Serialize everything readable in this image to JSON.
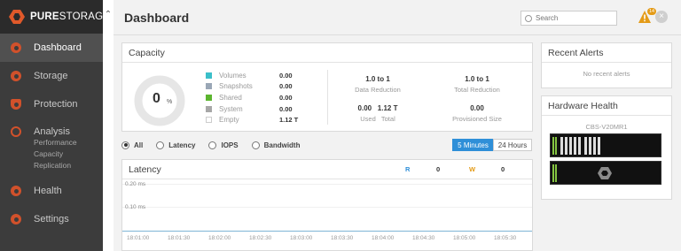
{
  "brand": {
    "bold": "PURE",
    "light": "STORAGE"
  },
  "sidebar": {
    "items": [
      {
        "label": "Dashboard",
        "icon": "dashboard-icon",
        "active": true
      },
      {
        "label": "Storage",
        "icon": "storage-icon",
        "active": false
      },
      {
        "label": "Protection",
        "icon": "shield-icon",
        "active": false
      },
      {
        "label": "Analysis",
        "icon": "analysis-icon",
        "active": false,
        "sub": [
          "Performance",
          "Capacity",
          "Replication"
        ]
      },
      {
        "label": "Health",
        "icon": "health-icon",
        "active": false
      },
      {
        "label": "Settings",
        "icon": "gear-icon",
        "active": false
      }
    ]
  },
  "header": {
    "title": "Dashboard",
    "search_placeholder": "Search",
    "alert_count": "14"
  },
  "capacity": {
    "title": "Capacity",
    "donut_value": "0",
    "donut_unit": "%",
    "legend": [
      {
        "label": "Volumes",
        "value": "0.00",
        "color": "#3bbfc9"
      },
      {
        "label": "Snapshots",
        "value": "0.00",
        "color": "#9aa7b6"
      },
      {
        "label": "Shared",
        "value": "0.00",
        "color": "#5cb52f"
      },
      {
        "label": "System",
        "value": "0.00",
        "color": "#a7a7a7"
      },
      {
        "label": "Empty",
        "value": "1.12 T",
        "color": "#ffffff"
      }
    ],
    "data_reduction": {
      "value": "1.0 to 1",
      "label": "Data Reduction"
    },
    "total_reduction": {
      "value": "1.0 to 1",
      "label": "Total Reduction"
    },
    "used_total": {
      "value": "0.00   1.12 T",
      "label": "Used   Total"
    },
    "provisioned": {
      "value": "0.00",
      "label": "Provisioned Size"
    }
  },
  "metric_filter": {
    "options": [
      {
        "label": "All",
        "selected": true
      },
      {
        "label": "Latency",
        "selected": false
      },
      {
        "label": "IOPS",
        "selected": false
      },
      {
        "label": "Bandwidth",
        "selected": false
      }
    ]
  },
  "time_range": {
    "options": [
      "5 Minutes",
      "24 Hours"
    ],
    "selected": "5 Minutes"
  },
  "latency": {
    "title": "Latency",
    "r_label": "R",
    "r_value": "0",
    "w_label": "W",
    "w_value": "0",
    "y_ticks": [
      "0.20 ms",
      "0.10 ms"
    ],
    "x_ticks": [
      "18:01:00",
      "18:01:30",
      "18:02:00",
      "18:02:30",
      "18:03:00",
      "18:03:30",
      "18:04:00",
      "18:04:30",
      "18:05:00",
      "18:05:30"
    ]
  },
  "alerts": {
    "title": "Recent Alerts",
    "empty_text": "No recent alerts"
  },
  "hardware": {
    "title": "Hardware Health",
    "chassis_name": "CBS-V20MR1"
  },
  "colors": {
    "accent": "#d1512b",
    "sidebar_bg": "#3c3c3c",
    "primary_blue": "#2f8fd8",
    "warn": "#e49b17"
  }
}
